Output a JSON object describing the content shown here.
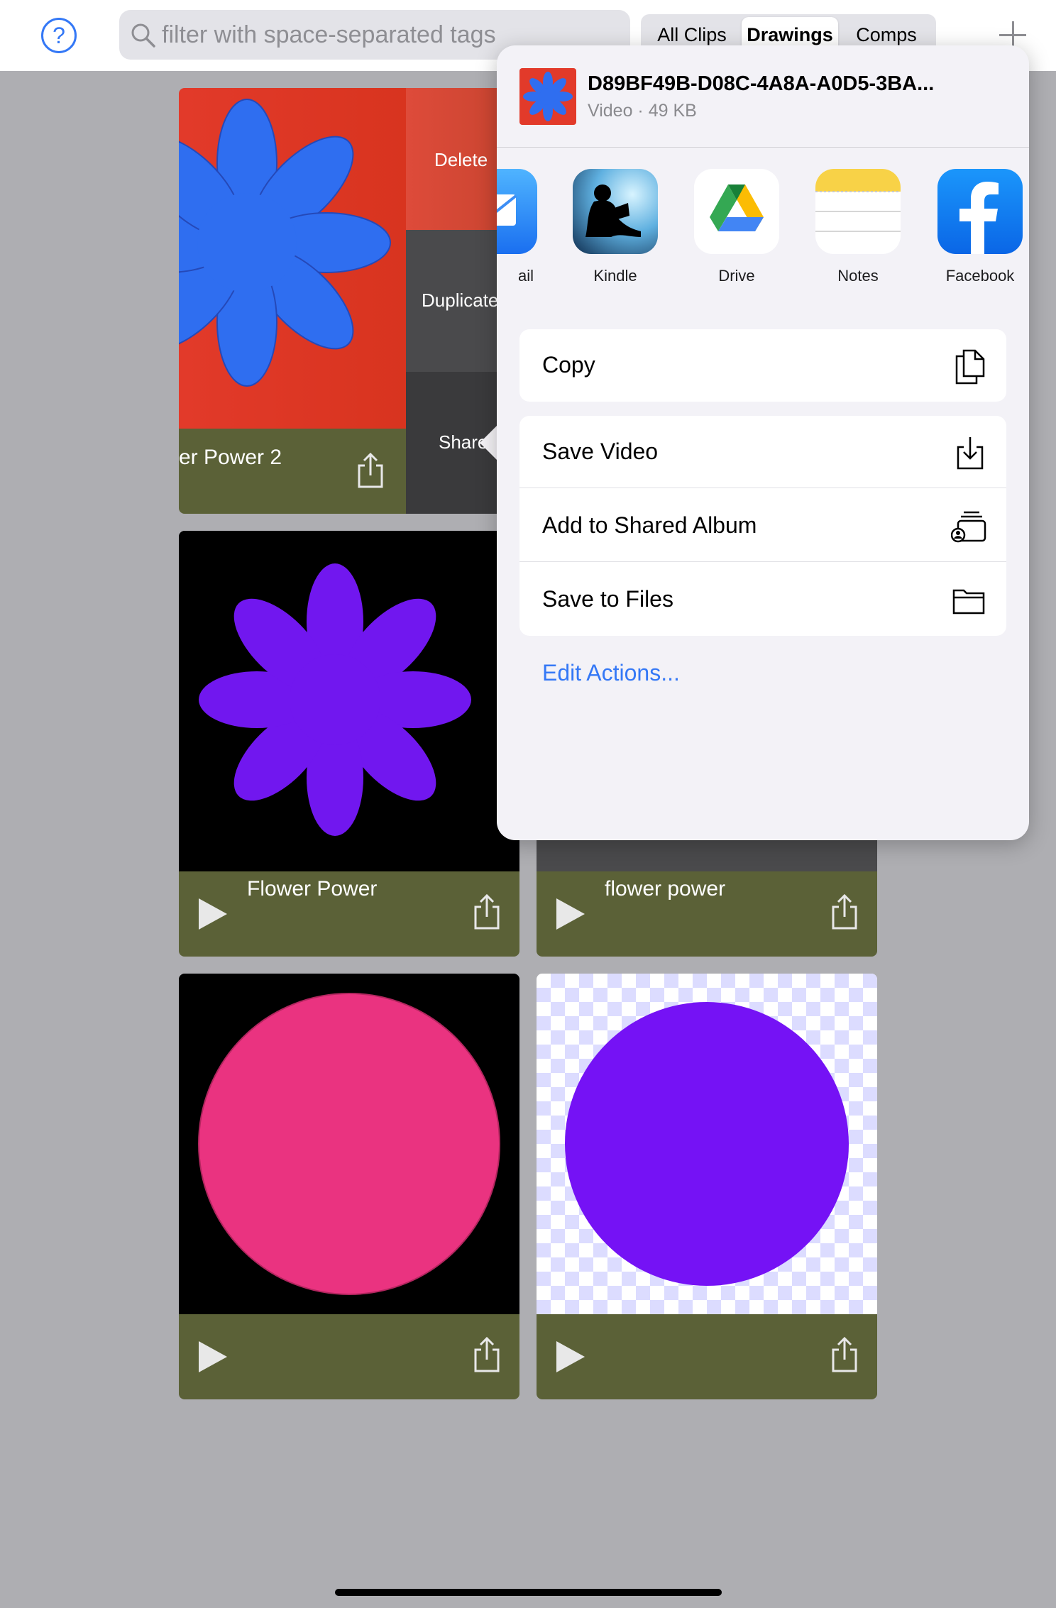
{
  "topbar": {
    "help_label": "?",
    "search_placeholder": "filter with space-separated tags",
    "segments": [
      "All Clips",
      "Drawings",
      "Comps"
    ],
    "selected_segment": "Drawings"
  },
  "swipe_actions": [
    "Delete",
    "Duplicate",
    "Share"
  ],
  "cards": [
    {
      "title": "er Power 2"
    },
    {
      "title": "Flower Power"
    },
    {
      "title": "flower power"
    },
    {
      "title": ""
    },
    {
      "title": ""
    }
  ],
  "share_sheet": {
    "title": "D89BF49B-D08C-4A8A-A0D5-3BA...",
    "subtitle": "Video · 49 KB",
    "apps": [
      {
        "label": "ail",
        "icon": "mail-icon"
      },
      {
        "label": "Kindle",
        "icon": "kindle-icon"
      },
      {
        "label": "Drive",
        "icon": "google-drive-icon"
      },
      {
        "label": "Notes",
        "icon": "notes-icon"
      },
      {
        "label": "Facebook",
        "icon": "facebook-icon"
      }
    ],
    "actions_group1": [
      {
        "label": "Copy",
        "icon": "copy-icon"
      }
    ],
    "actions_group2": [
      {
        "label": "Save Video",
        "icon": "save-download-icon"
      },
      {
        "label": "Add to Shared Album",
        "icon": "shared-album-icon"
      },
      {
        "label": "Save to Files",
        "icon": "folder-icon"
      }
    ],
    "edit_actions": "Edit Actions..."
  },
  "colors": {
    "accent": "#3478f6",
    "card_footer": "#5b6137",
    "delete_red": "#de4b3a",
    "flower_blue": "#2f6ef0",
    "flower_purple": "#7117ef",
    "pink_circle": "#ea3380",
    "purple_circle": "#7512f5"
  }
}
